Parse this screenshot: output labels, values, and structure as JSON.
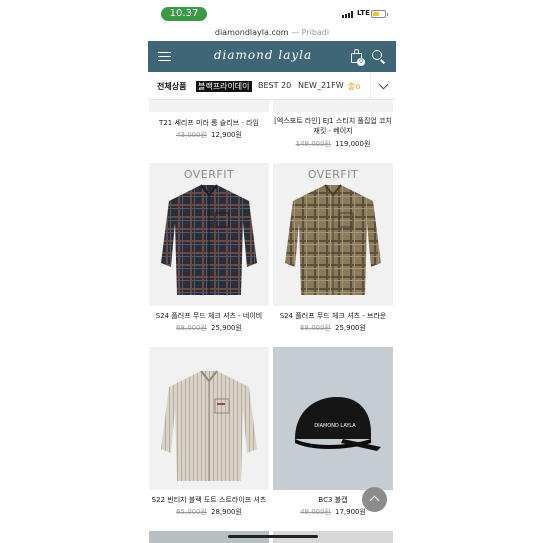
{
  "status_bar": {
    "time": "10.37",
    "network": "LTE",
    "battery_level": 0.55,
    "battery_color": "#f4c430",
    "time_pill_color": "#3a9a48"
  },
  "browser": {
    "url": "diamondlayla.com",
    "separator": " — ",
    "subtitle": "Pribadi"
  },
  "header": {
    "logo": "diamond layla",
    "cart_count": "0",
    "background": "#3f6676",
    "icons": [
      "menu-icon",
      "shopping-bag-icon",
      "search-icon"
    ]
  },
  "tabs": [
    {
      "label": "전체상품",
      "active": true
    },
    {
      "label": "블랙프라이데이"
    },
    {
      "label": "BEST 20"
    },
    {
      "label": "NEW_21FW"
    },
    {
      "label": "출o"
    }
  ],
  "products": [
    {
      "name": "T21 세리프 미러 롱 슬리브 - 라임",
      "original_price": "43,000원",
      "sale_price": "12,900원"
    },
    {
      "name": "[엑스포트 라인] EJ1 스티치 풀집업 코치 재킷 - 베이지",
      "original_price": "149,000원",
      "sale_price": "119,000원"
    },
    {
      "name": "S24 플러프 무드 체크 셔츠 - 네이비",
      "original_price": "68,000원",
      "sale_price": "25,900원",
      "badge": "OVERFIT"
    },
    {
      "name": "S24 플러프 무드 체크 셔츠 - 브라운",
      "original_price": "68,000원",
      "sale_price": "25,900원",
      "badge": "OVERFIT"
    },
    {
      "name": "S22 빈티지 블랙 도트 스트라이프 셔츠",
      "original_price": "65,000원",
      "sale_price": "28,900원"
    },
    {
      "name": "BC3 볼캡",
      "original_price": "49,000원",
      "sale_price": "17,900원",
      "cap_text": "DIAMOND LAYLA"
    }
  ]
}
